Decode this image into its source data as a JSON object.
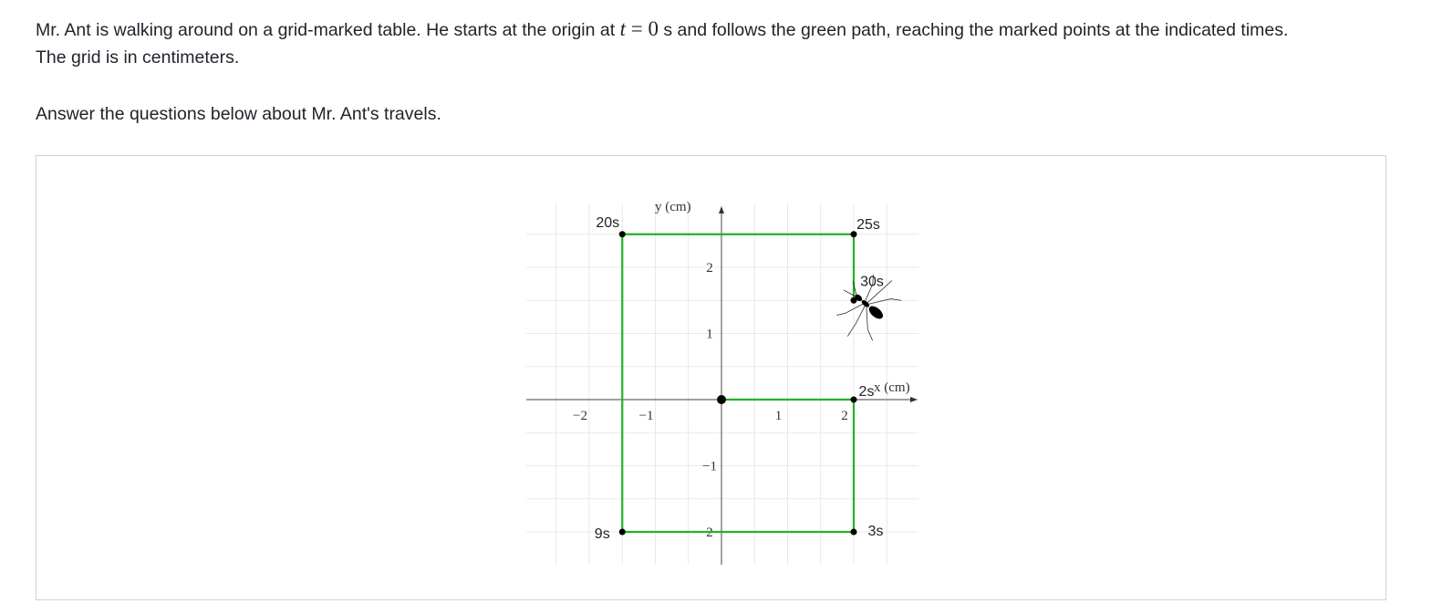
{
  "problem": {
    "intro_part1": "Mr. Ant is walking around on a grid-marked table. He starts at the origin at",
    "math_var": "t",
    "math_eq": " = 0",
    "intro_part2": " s and follows the green path, reaching the marked points at the indicated times.",
    "intro_line2": "The grid is in centimeters.",
    "instruction": "Answer the questions below about Mr. Ant's travels."
  },
  "graph": {
    "x_axis_label": "x (cm)",
    "y_axis_label": "y (cm)",
    "x_ticks": [
      {
        "value": -2,
        "label": "−2"
      },
      {
        "value": -1,
        "label": "−1"
      },
      {
        "value": 1,
        "label": "1"
      },
      {
        "value": 2,
        "label": "2"
      }
    ],
    "y_ticks": [
      {
        "value": 2,
        "label": "2"
      },
      {
        "value": 1,
        "label": "1"
      },
      {
        "value": -1,
        "label": "−1"
      },
      {
        "value": -2,
        "label": "2"
      }
    ],
    "path_color": "#22b322",
    "path": [
      [
        0,
        0
      ],
      [
        2,
        0
      ],
      [
        2,
        -2
      ],
      [
        -1.5,
        -2
      ],
      [
        -1.5,
        2.5
      ],
      [
        2,
        2.5
      ],
      [
        2,
        1.5
      ]
    ],
    "points": [
      {
        "name": "origin",
        "x": 0,
        "y": 0,
        "label": ""
      },
      {
        "name": "2s",
        "x": 2,
        "y": 0,
        "label": "2s"
      },
      {
        "name": "3s",
        "x": 2,
        "y": -2,
        "label": "3s"
      },
      {
        "name": "9s",
        "x": -1.5,
        "y": -2,
        "label": "9s"
      },
      {
        "name": "20s",
        "x": -1.5,
        "y": 2.5,
        "label": "20s"
      },
      {
        "name": "25s",
        "x": 2,
        "y": 2.5,
        "label": "25s"
      },
      {
        "name": "30s",
        "x": 2,
        "y": 1.5,
        "label": "30s"
      }
    ],
    "ant_icon": "ant-icon"
  }
}
